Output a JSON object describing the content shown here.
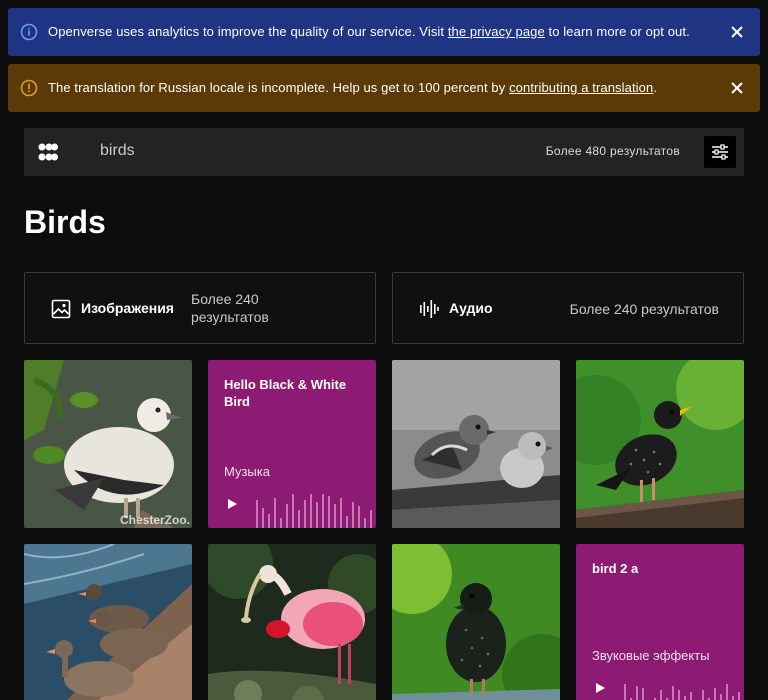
{
  "banners": {
    "analytics": {
      "text_before": "Openverse uses analytics to improve the quality of our service. Visit ",
      "link": "the privacy page",
      "text_after": " to learn more or opt out.",
      "icon": "info-icon",
      "color": "#1f3584"
    },
    "translation": {
      "text_before": "The translation for Russian locale is incomplete. Help us get to 100 percent by ",
      "link": "contributing a translation",
      "text_after": ".",
      "icon": "warning-icon",
      "color": "#5b3a07"
    }
  },
  "search": {
    "query": "birds",
    "result_count": "Более 480 результатов",
    "filter_icon": "filter-sliders-icon",
    "logo_icon": "openverse-logo-icon"
  },
  "page": {
    "title": "Birds"
  },
  "categories": {
    "images": {
      "label": "Изображения",
      "count": "Более 240 результатов",
      "icon": "image-icon"
    },
    "audio": {
      "label": "Аудио",
      "count": "Более 240 результатов",
      "icon": "audio-waveform-icon"
    }
  },
  "results": {
    "tile1": {
      "type": "image",
      "credit": "ChesterZoo."
    },
    "tile2": {
      "type": "audio",
      "title": "Hello Black & White Bird",
      "genre": "Музыка"
    },
    "tile3": {
      "type": "image"
    },
    "tile4": {
      "type": "image"
    },
    "tile5": {
      "type": "image"
    },
    "tile6": {
      "type": "image"
    },
    "tile7": {
      "type": "image"
    },
    "tile8": {
      "type": "audio",
      "title": "bird 2 a",
      "genre": "Звуковые эффекты"
    }
  },
  "colors": {
    "background": "#0d0d0d",
    "audio_tile": "#8d1a73",
    "search_bar": "#232323"
  }
}
